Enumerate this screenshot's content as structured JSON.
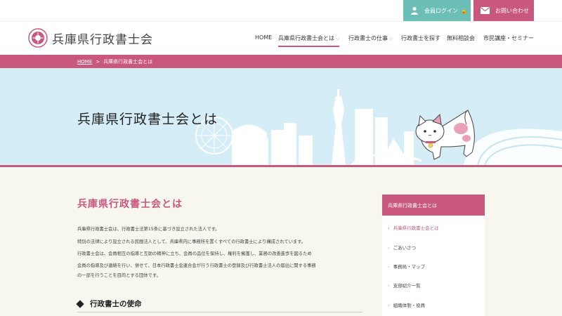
{
  "topbar": {
    "login_label": "会員ログイン",
    "contact_label": "お問い合わせ"
  },
  "header": {
    "logo_text": "兵庫県行政書士会",
    "nav": [
      "HOME",
      "兵庫県行政書士会とは",
      "行政書士の仕事",
      "行政書士を探す",
      "無料相談会",
      "市民講座・セミナー"
    ]
  },
  "breadcrumb": {
    "home": "HOME",
    "separator": ">",
    "current": "兵庫県行政書士会とは"
  },
  "hero": {
    "title": "兵庫県行政書士会とは"
  },
  "main": {
    "heading": "兵庫県行政書士会とは",
    "paragraphs": [
      "兵庫県行政書士会は、行政書士法第15条に基づき設立された法人です。",
      "特別の法律により設立される民間法人として、兵庫県内に事務所を置くすべての行政書士により構成されています。",
      "行政書士会は、会員相互の指導と互助の精神に立ち、会員の品位を保持し、権利を擁護し、業務の改善進歩を図るため",
      "会員の指導及び連絡を行い、併せて、日本行政書士会連合会が行う行政書士の登録及び行政書士法人の届出に関する事務",
      "の一部を行うことを目的とする団体です。"
    ],
    "section_title": "行政書士の使命"
  },
  "sidebar": {
    "title": "兵庫県行政書士会とは",
    "items": [
      "兵庫県行政書士会とは",
      "ごあいさつ",
      "事務局・マップ",
      "支部紹介一覧",
      "組織体制・役員"
    ]
  },
  "colors": {
    "accent": "#c9587f",
    "teal": "#6cbfb6",
    "hero_bg": "#d4edf7",
    "content_bg": "#f7f6ef"
  }
}
